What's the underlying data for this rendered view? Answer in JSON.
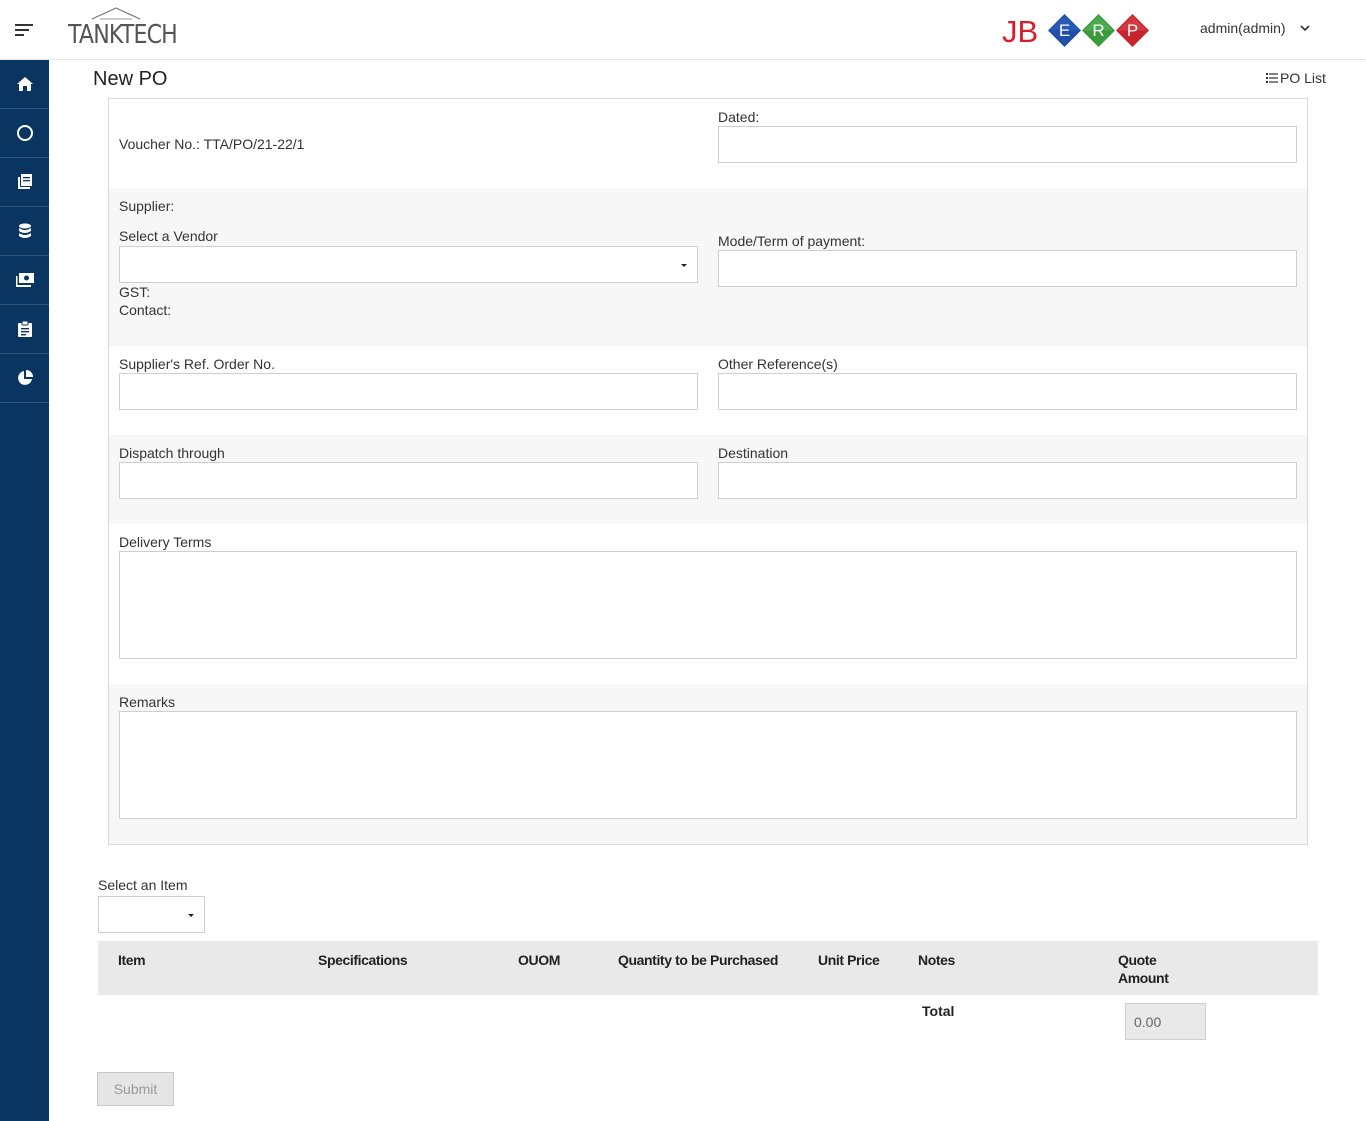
{
  "header": {
    "brand_name": "TANKTECH",
    "erp_logo": {
      "prefix": "JB",
      "letters": [
        "E",
        "R",
        "P"
      ],
      "colors": [
        "#1f4fa8",
        "#3a9a3c",
        "#c7242e"
      ]
    },
    "user_label": "admin(admin)"
  },
  "sidebar": {
    "items": [
      {
        "icon": "home-icon"
      },
      {
        "icon": "circle-icon"
      },
      {
        "icon": "books-icon"
      },
      {
        "icon": "database-icon"
      },
      {
        "icon": "money-icon"
      },
      {
        "icon": "clipboard-icon"
      },
      {
        "icon": "pie-chart-icon"
      }
    ],
    "bg_color": "#0a3561"
  },
  "page": {
    "title": "New PO",
    "po_list_link": "PO List"
  },
  "form": {
    "voucher_label": "Voucher No.: TTA/PO/21-22/1",
    "dated_label": "Dated:",
    "dated_value": "",
    "supplier_label": "Supplier:",
    "vendor_label": "Select a Vendor",
    "vendor_value": "",
    "gst_label": "GST:",
    "contact_label": "Contact:",
    "payment_label": "Mode/Term of payment:",
    "payment_value": "",
    "supplier_ref_label": "Supplier's Ref. Order No.",
    "supplier_ref_value": "",
    "other_ref_label": "Other Reference(s)",
    "other_ref_value": "",
    "dispatch_label": "Dispatch through",
    "dispatch_value": "",
    "destination_label": "Destination",
    "destination_value": "",
    "delivery_terms_label": "Delivery Terms",
    "delivery_terms_value": "",
    "remarks_label": "Remarks",
    "remarks_value": ""
  },
  "items": {
    "select_label": "Select an Item",
    "select_value": "",
    "columns": [
      "Item",
      "Specifications",
      "OUOM",
      "Quantity to be Purchased",
      "Unit Price",
      "Notes",
      "Quote Amount"
    ],
    "total_label": "Total",
    "total_value": "0.00"
  },
  "actions": {
    "submit_label": "Submit"
  }
}
